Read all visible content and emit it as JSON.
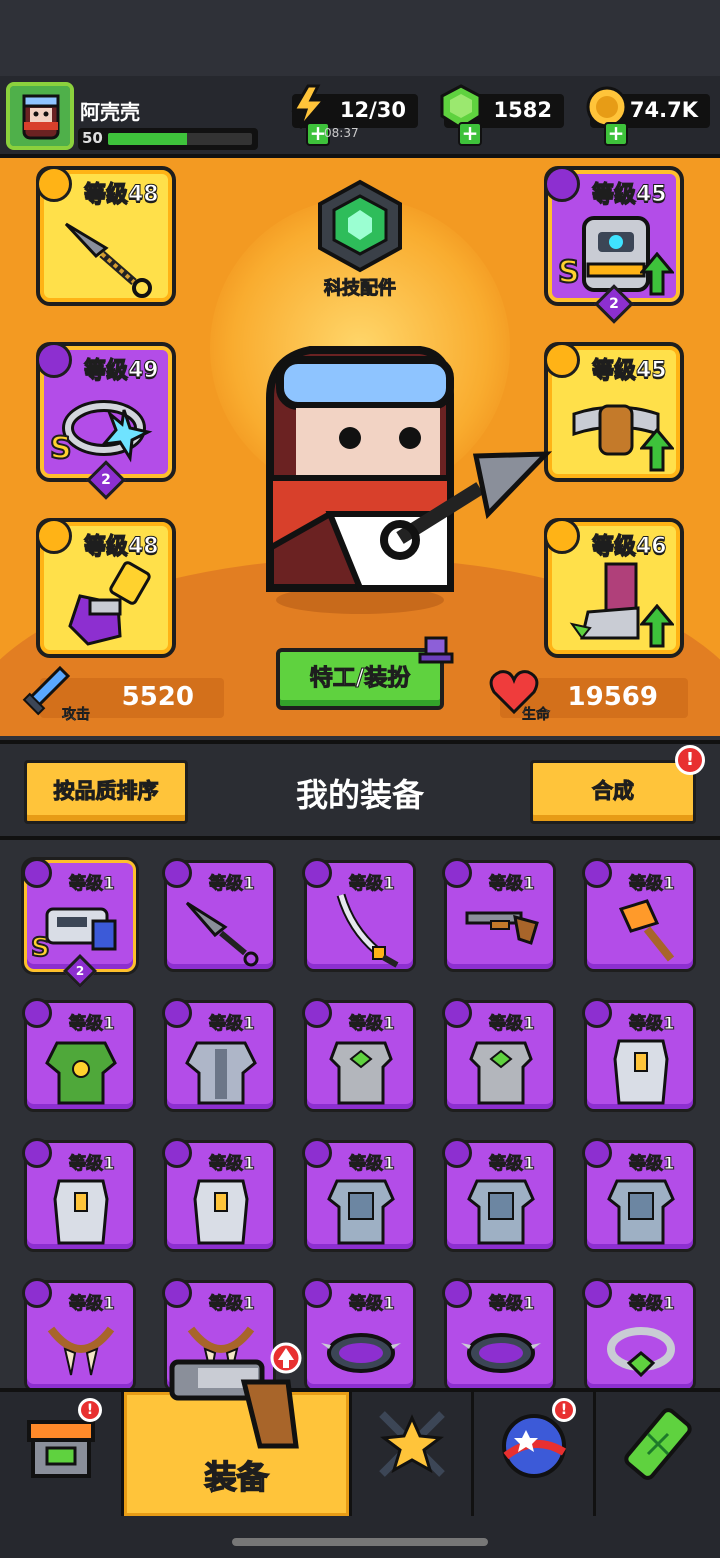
{
  "player": {
    "name": "阿壳壳",
    "level": "50",
    "xp_fraction": 0.55
  },
  "resources": {
    "energy": {
      "icon": "lightning-icon",
      "value": "12/30",
      "timer": "08:37"
    },
    "gems": {
      "icon": "green-gem-icon",
      "value": "1582"
    },
    "coins": {
      "icon": "gold-coin-icon",
      "value": "74.7K"
    }
  },
  "equipped": {
    "weapon": {
      "level_label": "等级48",
      "rarity": "yellow",
      "icon": "kunai-icon",
      "category": "weapon-icon"
    },
    "armor": {
      "level_label": "等级45",
      "rarity": "purple",
      "icon": "armor-icon",
      "category": "shirt-icon",
      "tier": "S",
      "stars": "2"
    },
    "necklace": {
      "level_label": "等级49",
      "rarity": "purple",
      "icon": "ring-icon",
      "category": "necklace-icon",
      "tier": "S",
      "stars": "2"
    },
    "belt": {
      "level_label": "等级45",
      "rarity": "yellow",
      "icon": "belt-icon",
      "category": "belt-icon"
    },
    "gloves": {
      "level_label": "等级48",
      "rarity": "yellow",
      "icon": "gauntlet-icon",
      "category": "glove-icon"
    },
    "boots": {
      "level_label": "等级46",
      "rarity": "yellow",
      "icon": "boot-icon",
      "category": "boot-icon"
    }
  },
  "tech": {
    "label": "科技配件"
  },
  "stats": {
    "attack": {
      "label": "攻击",
      "value": "5520"
    },
    "health": {
      "label": "生命",
      "value": "19569"
    }
  },
  "agent_button": "特工/装扮",
  "equipment": {
    "sort_button": "按品质排序",
    "title": "我的装备",
    "merge_button": "合成",
    "merge_alert": "!",
    "items": [
      {
        "level_label": "等级1",
        "icon": "blaster-icon",
        "tier": "S",
        "stars": "2",
        "selected": true
      },
      {
        "level_label": "等级1",
        "icon": "kunai-icon"
      },
      {
        "level_label": "等级1",
        "icon": "katana-icon"
      },
      {
        "level_label": "等级1",
        "icon": "shotgun-icon"
      },
      {
        "level_label": "等级1",
        "icon": "torch-icon"
      },
      {
        "level_label": "等级1",
        "icon": "leaf-armor-icon"
      },
      {
        "level_label": "等级1",
        "icon": "steel-armor-icon"
      },
      {
        "level_label": "等级1",
        "icon": "gem-vest-icon"
      },
      {
        "level_label": "等级1",
        "icon": "gem-vest-icon"
      },
      {
        "level_label": "等级1",
        "icon": "plate-vest-icon"
      },
      {
        "level_label": "等级1",
        "icon": "plate-vest-icon"
      },
      {
        "level_label": "等级1",
        "icon": "plate-vest-icon"
      },
      {
        "level_label": "等级1",
        "icon": "chain-vest-icon"
      },
      {
        "level_label": "等级1",
        "icon": "chain-vest-icon"
      },
      {
        "level_label": "等级1",
        "icon": "chain-vest-icon"
      },
      {
        "level_label": "等级1",
        "icon": "fang-necklace-icon"
      },
      {
        "level_label": "等级1",
        "icon": "fang-necklace-icon"
      },
      {
        "level_label": "等级1",
        "icon": "spiked-collar-icon"
      },
      {
        "level_label": "等级1",
        "icon": "spiked-collar-icon"
      },
      {
        "level_label": "等级1",
        "icon": "gem-ring-icon"
      }
    ]
  },
  "nav": {
    "items": [
      {
        "name": "shop",
        "icon": "shop-icon",
        "alert": "!"
      },
      {
        "name": "equipment",
        "icon": "revolver-icon",
        "label": "装备",
        "active": true
      },
      {
        "name": "battle",
        "icon": "crossed-swords-star-icon"
      },
      {
        "name": "challenge",
        "icon": "star-planet-icon",
        "alert": "!"
      },
      {
        "name": "lab",
        "icon": "dna-vial-icon"
      }
    ]
  }
}
